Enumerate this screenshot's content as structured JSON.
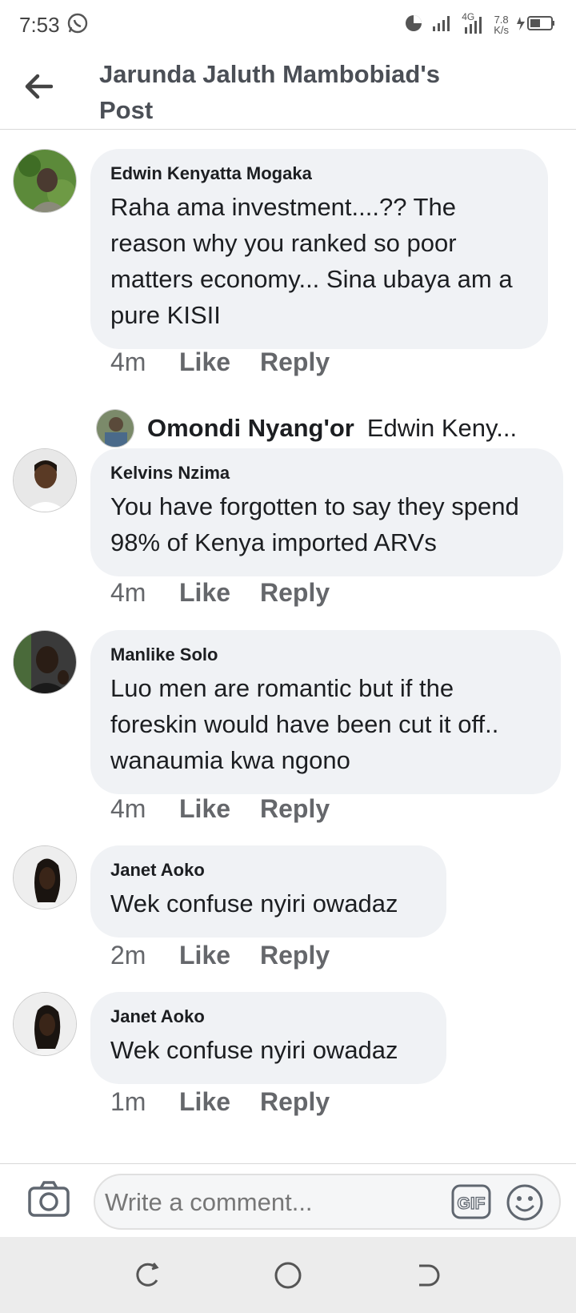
{
  "status": {
    "time": "7:53",
    "network": "4G",
    "speed_value": "7.8",
    "speed_unit": "K/s"
  },
  "header": {
    "title": "Jarunda Jaluth Mambobiad's Post"
  },
  "comments": [
    {
      "author": "Edwin Kenyatta Mogaka",
      "text": "Raha ama investment....??  The reason why you ranked so poor matters economy... Sina ubaya am a pure KISII",
      "time": "4m",
      "like": "Like",
      "reply": "Reply"
    },
    {
      "author": "Kelvins Nzima",
      "text": "You have forgotten to say they spend 98% of Kenya imported ARVs",
      "time": "4m",
      "like": "Like",
      "reply": "Reply"
    },
    {
      "author": "Manlike Solo",
      "text": "Luo men are romantic but if the foreskin would have been cut it off.. wanaumia kwa ngono",
      "time": "4m",
      "like": "Like",
      "reply": "Reply"
    },
    {
      "author": "Janet Aoko",
      "text": "Wek confuse nyiri owadaz",
      "time": "2m",
      "like": "Like",
      "reply": "Reply"
    },
    {
      "author": "Janet Aoko",
      "text": "Wek confuse nyiri owadaz",
      "time": "1m",
      "like": "Like",
      "reply": "Reply"
    }
  ],
  "reply_preview": {
    "author": "Omondi Nyang'or",
    "text": "Edwin Keny..."
  },
  "composer": {
    "placeholder": "Write a comment...",
    "gif_label": "GIF"
  },
  "icons": {
    "back": "arrow-left-icon",
    "camera": "camera-icon",
    "emoji": "smiley-icon",
    "nav_recent": "recent-apps-icon",
    "nav_home": "home-circle-icon",
    "nav_back": "nav-back-icon"
  },
  "colors": {
    "bubble": "#f0f2f5",
    "meta_text": "#65676b",
    "title_text": "#4b4f56"
  }
}
